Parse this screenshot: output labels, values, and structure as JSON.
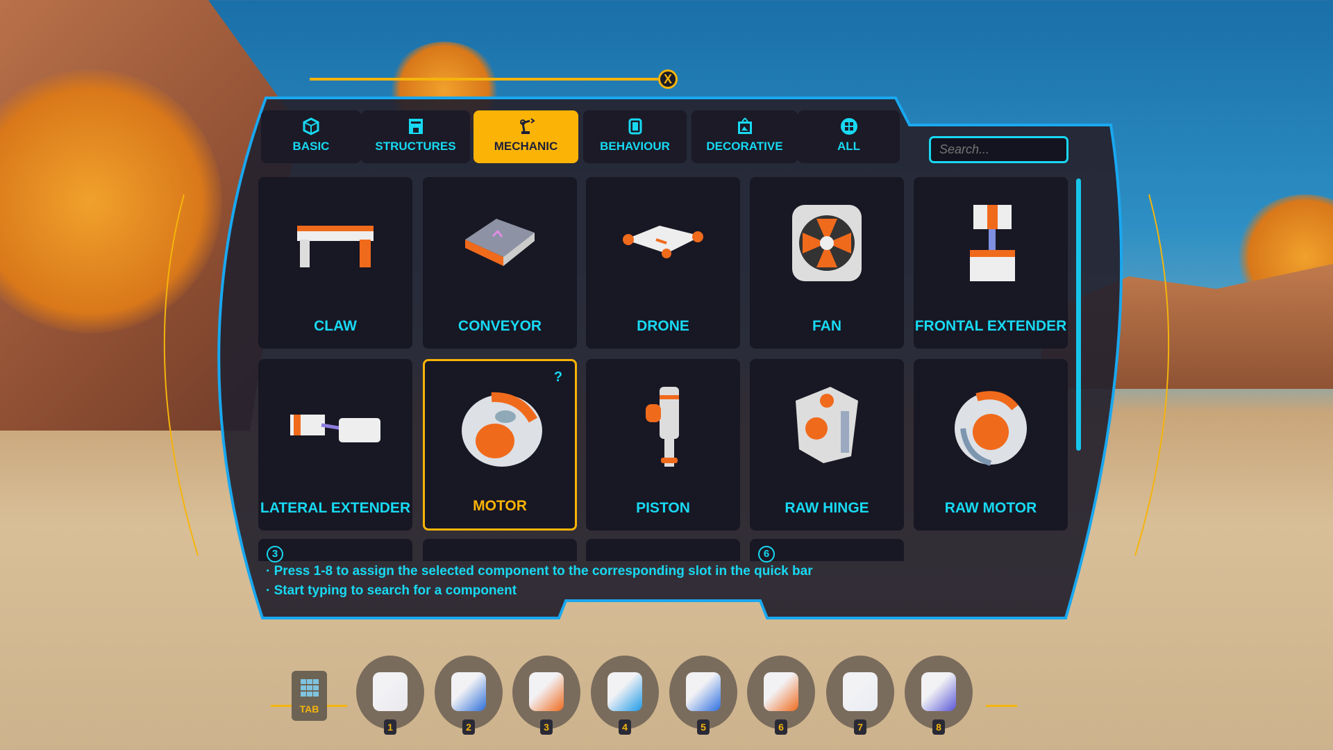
{
  "colors": {
    "accent": "#18d9f2",
    "selected": "#fbb406",
    "panel": "#2a2733"
  },
  "tabs": [
    {
      "label": "BASIC",
      "icon": "cube-icon"
    },
    {
      "label": "STRUCTURES",
      "icon": "structure-icon"
    },
    {
      "label": "MECHANIC",
      "icon": "robot-arm-icon",
      "active": true
    },
    {
      "label": "BEHAVIOUR",
      "icon": "chip-icon"
    },
    {
      "label": "DECORATIVE",
      "icon": "picture-frame-icon"
    },
    {
      "label": "ALL",
      "icon": "grid-dots-icon"
    }
  ],
  "search": {
    "placeholder": "Search..."
  },
  "components": [
    {
      "label": "CLAW"
    },
    {
      "label": "CONVEYOR"
    },
    {
      "label": "DRONE"
    },
    {
      "label": "FAN"
    },
    {
      "label": "FRONTAL EXTENDER"
    },
    {
      "label": "LATERAL EXTENDER"
    },
    {
      "label": "MOTOR",
      "selected": true,
      "help": "?"
    },
    {
      "label": "PISTON"
    },
    {
      "label": "RAW HINGE"
    },
    {
      "label": "RAW MOTOR"
    }
  ],
  "partial_row": [
    {
      "slot": "3"
    },
    {
      "slot": ""
    },
    {
      "slot": ""
    },
    {
      "slot": "6"
    }
  ],
  "help": [
    "· Press 1-8 to assign the selected component to the corresponding slot in the quick bar",
    "· Start typing to search for a component"
  ],
  "quickbar": {
    "tab_label": "TAB",
    "slots": [
      "1",
      "2",
      "3",
      "4",
      "5",
      "6",
      "7",
      "8"
    ]
  },
  "close_label": "X"
}
